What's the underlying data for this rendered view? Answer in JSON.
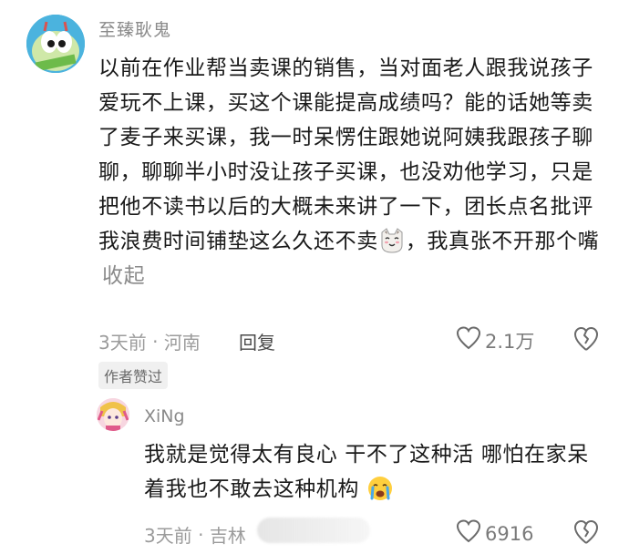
{
  "comment": {
    "username": "至臻耿鬼",
    "text": "以前在作业帮当卖课的销售，当对面老人跟我说孩子爱玩不上课，买这个课能提高成绩吗？能的话她等卖了麦子来买课，我一时呆愣住跟她说阿姨我跟孩子聊聊，聊聊半小时没让孩子买课，也没劝他学习，只是把他不读书以后的大概未来讲了一下，团长点名批评我浪费时间铺垫这么久还不卖",
    "text_after_emoji": "，我真张不开那个嘴",
    "collapse_label": "收起",
    "time": "3天前",
    "location": "河南",
    "reply_label": "回复",
    "like_count": "2.1万",
    "badge": "作者赞过"
  },
  "reply": {
    "username": "XiNg",
    "text": "我就是觉得太有良心 干不了这种活 哪怕在家呆着我也不敢去这种机构",
    "time": "3天前",
    "location": "吉林",
    "like_count": "6916"
  },
  "icons": {
    "like": "heart-outline-icon",
    "dislike": "broken-heart-icon",
    "cat_emoji": "cat-face-emoji",
    "cry_emoji": "crying-face-emoji"
  }
}
